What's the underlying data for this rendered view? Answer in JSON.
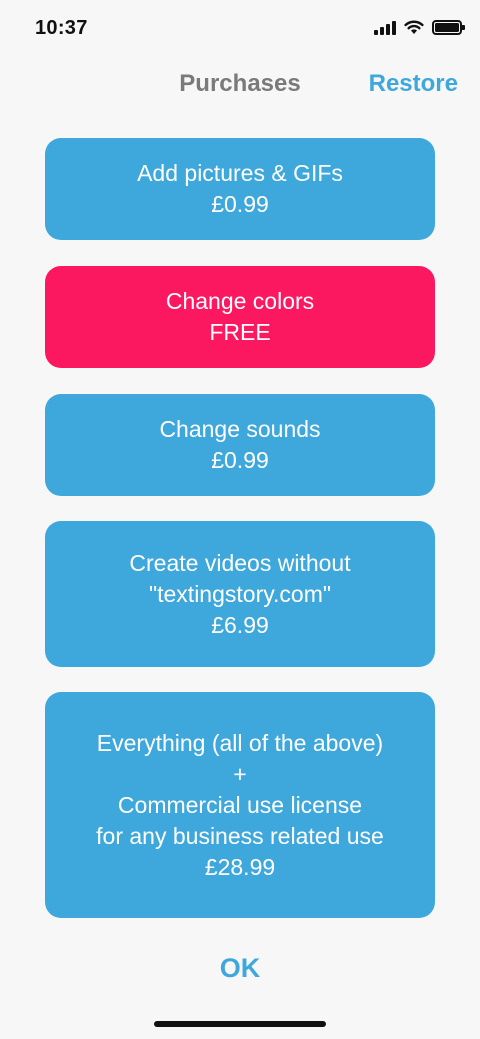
{
  "status_bar": {
    "time": "10:37"
  },
  "nav": {
    "title": "Purchases",
    "restore_label": "Restore"
  },
  "purchases": [
    {
      "lines": [
        "Add pictures & GIFs",
        "£0.99"
      ]
    },
    {
      "lines": [
        "Change colors",
        "FREE"
      ]
    },
    {
      "lines": [
        "Change sounds",
        "£0.99"
      ]
    },
    {
      "lines": [
        "Create videos without",
        "\"textingstory.com\"",
        "£6.99"
      ]
    },
    {
      "lines": [
        "Everything (all of the above)",
        "+",
        "Commercial use license",
        "for any business related use",
        "£28.99"
      ]
    }
  ],
  "footer": {
    "ok_label": "OK"
  },
  "colors": {
    "accent": "#3ea8dc",
    "highlight": "#fc1761",
    "background": "#f7f7f7"
  }
}
